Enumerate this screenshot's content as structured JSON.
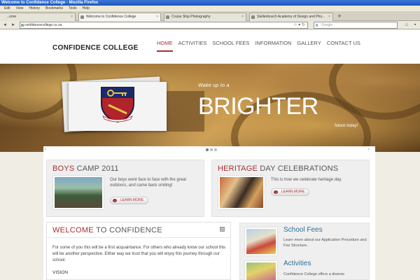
{
  "browser": {
    "window_title": "Welcome to Confidence College - Mozilla Firefox",
    "menu": [
      "Edit",
      "View",
      "History",
      "Bookmarks",
      "Tools",
      "Help"
    ],
    "tabs": [
      {
        "label": "...orne"
      },
      {
        "label": "Welcome to Confidence College"
      },
      {
        "label": "Cruise Ship Photography"
      },
      {
        "label": "Stellenbosch Academy of Design and Pho..."
      }
    ],
    "new_tab": "+",
    "url": "confidencecollege.co.za",
    "search_placeholder": "Google"
  },
  "site": {
    "logo": "CONFIDENCE COLLEGE",
    "nav": [
      "HOME",
      "ACTIVITIES",
      "SCHOOL FEES",
      "INFORMATION",
      "GALLERY",
      "CONTACT US"
    ],
    "hero": {
      "tagline_top": "Wake up to a",
      "headline": "BRIGHTER",
      "tagline_bottom": "future today!",
      "crest_motto": "CONFIDO IN DEO"
    },
    "slider": {
      "prev": "‹",
      "next": "›"
    },
    "boys_camp": {
      "title_red": "BOYS",
      "title_rest": " CAMP 2011",
      "text": "Our boys went face to face with the great outdoors, and came back smiling!",
      "more": "LEARN MORE"
    },
    "heritage": {
      "title_red": "HERITAGE",
      "title_rest": " DAY CELEBRATIONS",
      "text": "This is how we celebrate heritage day.",
      "more": "LEARN MORE"
    },
    "welcome": {
      "title_red": "WELCOME",
      "title_rest": " TO CONFIDENCE",
      "text": "For some of you this will be a first acquaintance. For others who already know our school this will be another perspective. Either way we trust that you will enjoy this journey through our school.",
      "subheading": "VISION"
    },
    "sidebar": {
      "fees_title": "School Fees",
      "fees_text": "Learn more about our Application Procedure and Fee Structure.",
      "activities_title": "Activities",
      "activities_text": "Confidence College offers a diverse"
    }
  },
  "colors": {
    "accent_red": "#a63030",
    "link_blue": "#2f6f9a",
    "page_bg": "#f0eee4"
  }
}
